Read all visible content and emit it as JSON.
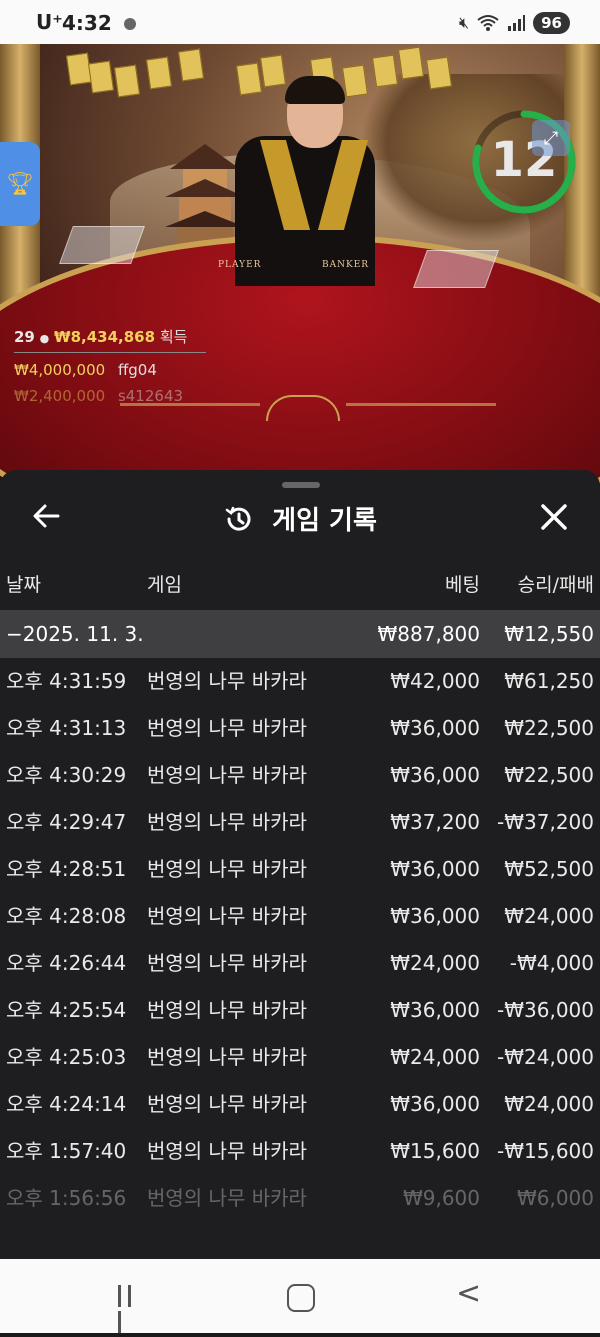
{
  "status_bar": {
    "carrier": "U⁺",
    "time": "4:32",
    "battery": "96"
  },
  "game_overlay": {
    "timer": "12",
    "winners_count": "29",
    "total_win": "₩8,434,868",
    "win_label": "획득",
    "top_winners": [
      {
        "amount": "₩4,000,000",
        "user": "ffg04"
      },
      {
        "amount": "₩2,400,000",
        "user": "s412643"
      }
    ],
    "table_labels": [
      "PLAYER",
      "BANKER"
    ]
  },
  "panel": {
    "title": "게임 기록",
    "columns": {
      "date": "날짜",
      "game": "게임",
      "bet": "베팅",
      "result": "승리/패배"
    },
    "summary": {
      "date": "−2025. 11. 3.",
      "bet": "₩887,800",
      "result": "₩12,550"
    },
    "rows": [
      {
        "time": "오후 4:31:59",
        "game": "번영의 나무 바카라",
        "bet": "₩42,000",
        "result": "₩61,250"
      },
      {
        "time": "오후 4:31:13",
        "game": "번영의 나무 바카라",
        "bet": "₩36,000",
        "result": "₩22,500"
      },
      {
        "time": "오후 4:30:29",
        "game": "번영의 나무 바카라",
        "bet": "₩36,000",
        "result": "₩22,500"
      },
      {
        "time": "오후 4:29:47",
        "game": "번영의 나무 바카라",
        "bet": "₩37,200",
        "result": "-₩37,200"
      },
      {
        "time": "오후 4:28:51",
        "game": "번영의 나무 바카라",
        "bet": "₩36,000",
        "result": "₩52,500"
      },
      {
        "time": "오후 4:28:08",
        "game": "번영의 나무 바카라",
        "bet": "₩36,000",
        "result": "₩24,000"
      },
      {
        "time": "오후 4:26:44",
        "game": "번영의 나무 바카라",
        "bet": "₩24,000",
        "result": "-₩4,000"
      },
      {
        "time": "오후 4:25:54",
        "game": "번영의 나무 바카라",
        "bet": "₩36,000",
        "result": "-₩36,000"
      },
      {
        "time": "오후 4:25:03",
        "game": "번영의 나무 바카라",
        "bet": "₩24,000",
        "result": "-₩24,000"
      },
      {
        "time": "오후 4:24:14",
        "game": "번영의 나무 바카라",
        "bet": "₩36,000",
        "result": "₩24,000"
      },
      {
        "time": "오후 1:57:40",
        "game": "번영의 나무 바카라",
        "bet": "₩15,600",
        "result": "-₩15,600"
      },
      {
        "time": "오후 1:56:56",
        "game": "번영의 나무 바카라",
        "bet": "₩9,600",
        "result": "₩6,000"
      }
    ]
  },
  "icons": {
    "back": "arrow-left-icon",
    "history": "history-clock-icon",
    "close": "close-icon",
    "trophy": "trophy-icon",
    "expand": "expand-icon"
  }
}
